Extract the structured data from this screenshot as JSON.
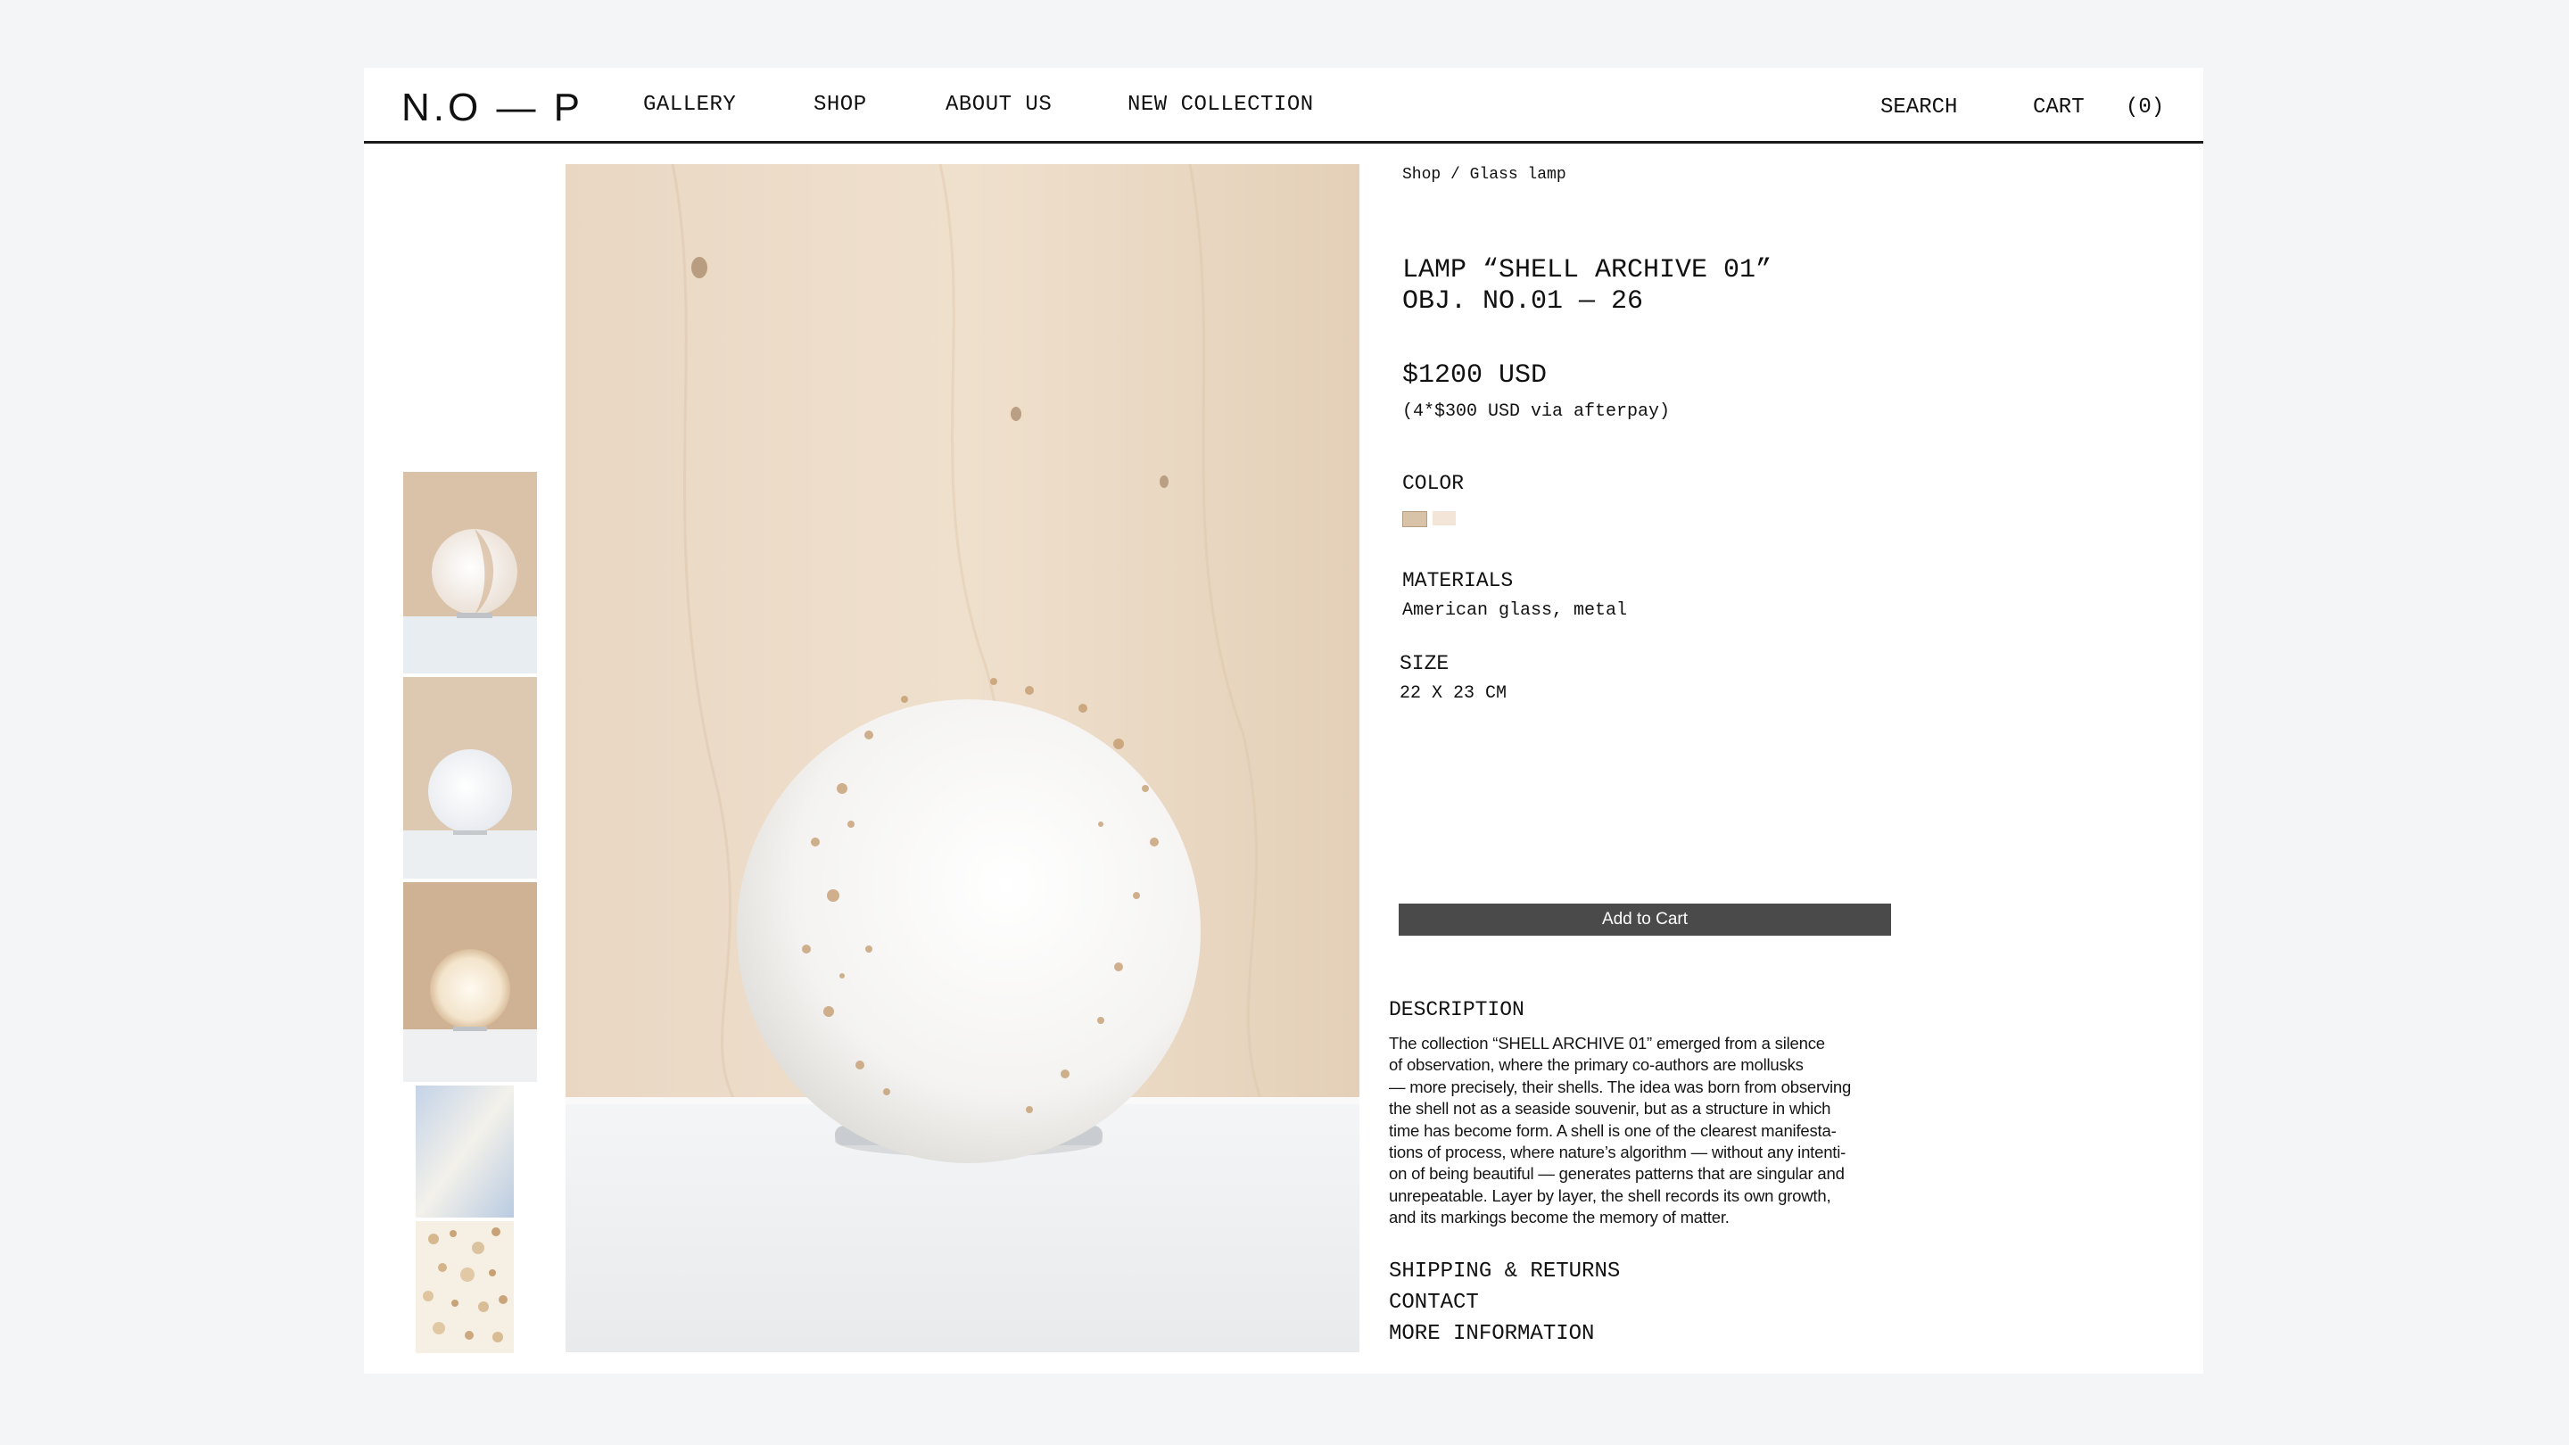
{
  "header": {
    "logo": "N.O — P",
    "nav": [
      "GALLERY",
      "SHOP",
      "ABOUT US",
      "NEW COLLECTION"
    ],
    "search_label": "SEARCH",
    "cart_label": "CART",
    "cart_count": "(0)"
  },
  "product": {
    "breadcrumb": "Shop / Glass lamp",
    "title_line1": "LAMP “SHELL ARCHIVE 01”",
    "title_line2": "OBJ. NO.01 — 26",
    "price": "$1200 USD",
    "installment": "(4*$300 USD via afterpay)",
    "color_label": "COLOR",
    "color_swatches": [
      "#d9c3a8",
      "#f3e6d8"
    ],
    "materials_label": "MATERIALS",
    "materials_value": "American glass, metal",
    "size_label": "SIZE",
    "size_value": "22 X 23 CM",
    "add_to_cart": "Add to Cart",
    "description_label": "DESCRIPTION",
    "description_lines": [
      "The collection “SHELL ARCHIVE 01” emerged from a silence",
      "of observation, where the primary co-authors are mollusks",
      "— more precisely, their shells. The idea was born from observing",
      "the shell not as a seaside souvenir, but as a structure in which",
      "time has become form. A shell is one of the clearest manifesta-",
      "tions of process, where nature’s algorithm — without any intenti-",
      "on of being beautiful — generates patterns that are singular and",
      "unrepeatable. Layer by layer, the shell records its own growth,",
      "and its markings become the memory of matter."
    ],
    "links": [
      "SHIPPING & RETURNS",
      "CONTACT",
      "MORE INFORMATION"
    ]
  },
  "colors": {
    "page_bg": "#f4f5f7",
    "button_bg": "#4a4a4a",
    "wood": "#e8d6c0",
    "glass": "#f3f1ee"
  }
}
